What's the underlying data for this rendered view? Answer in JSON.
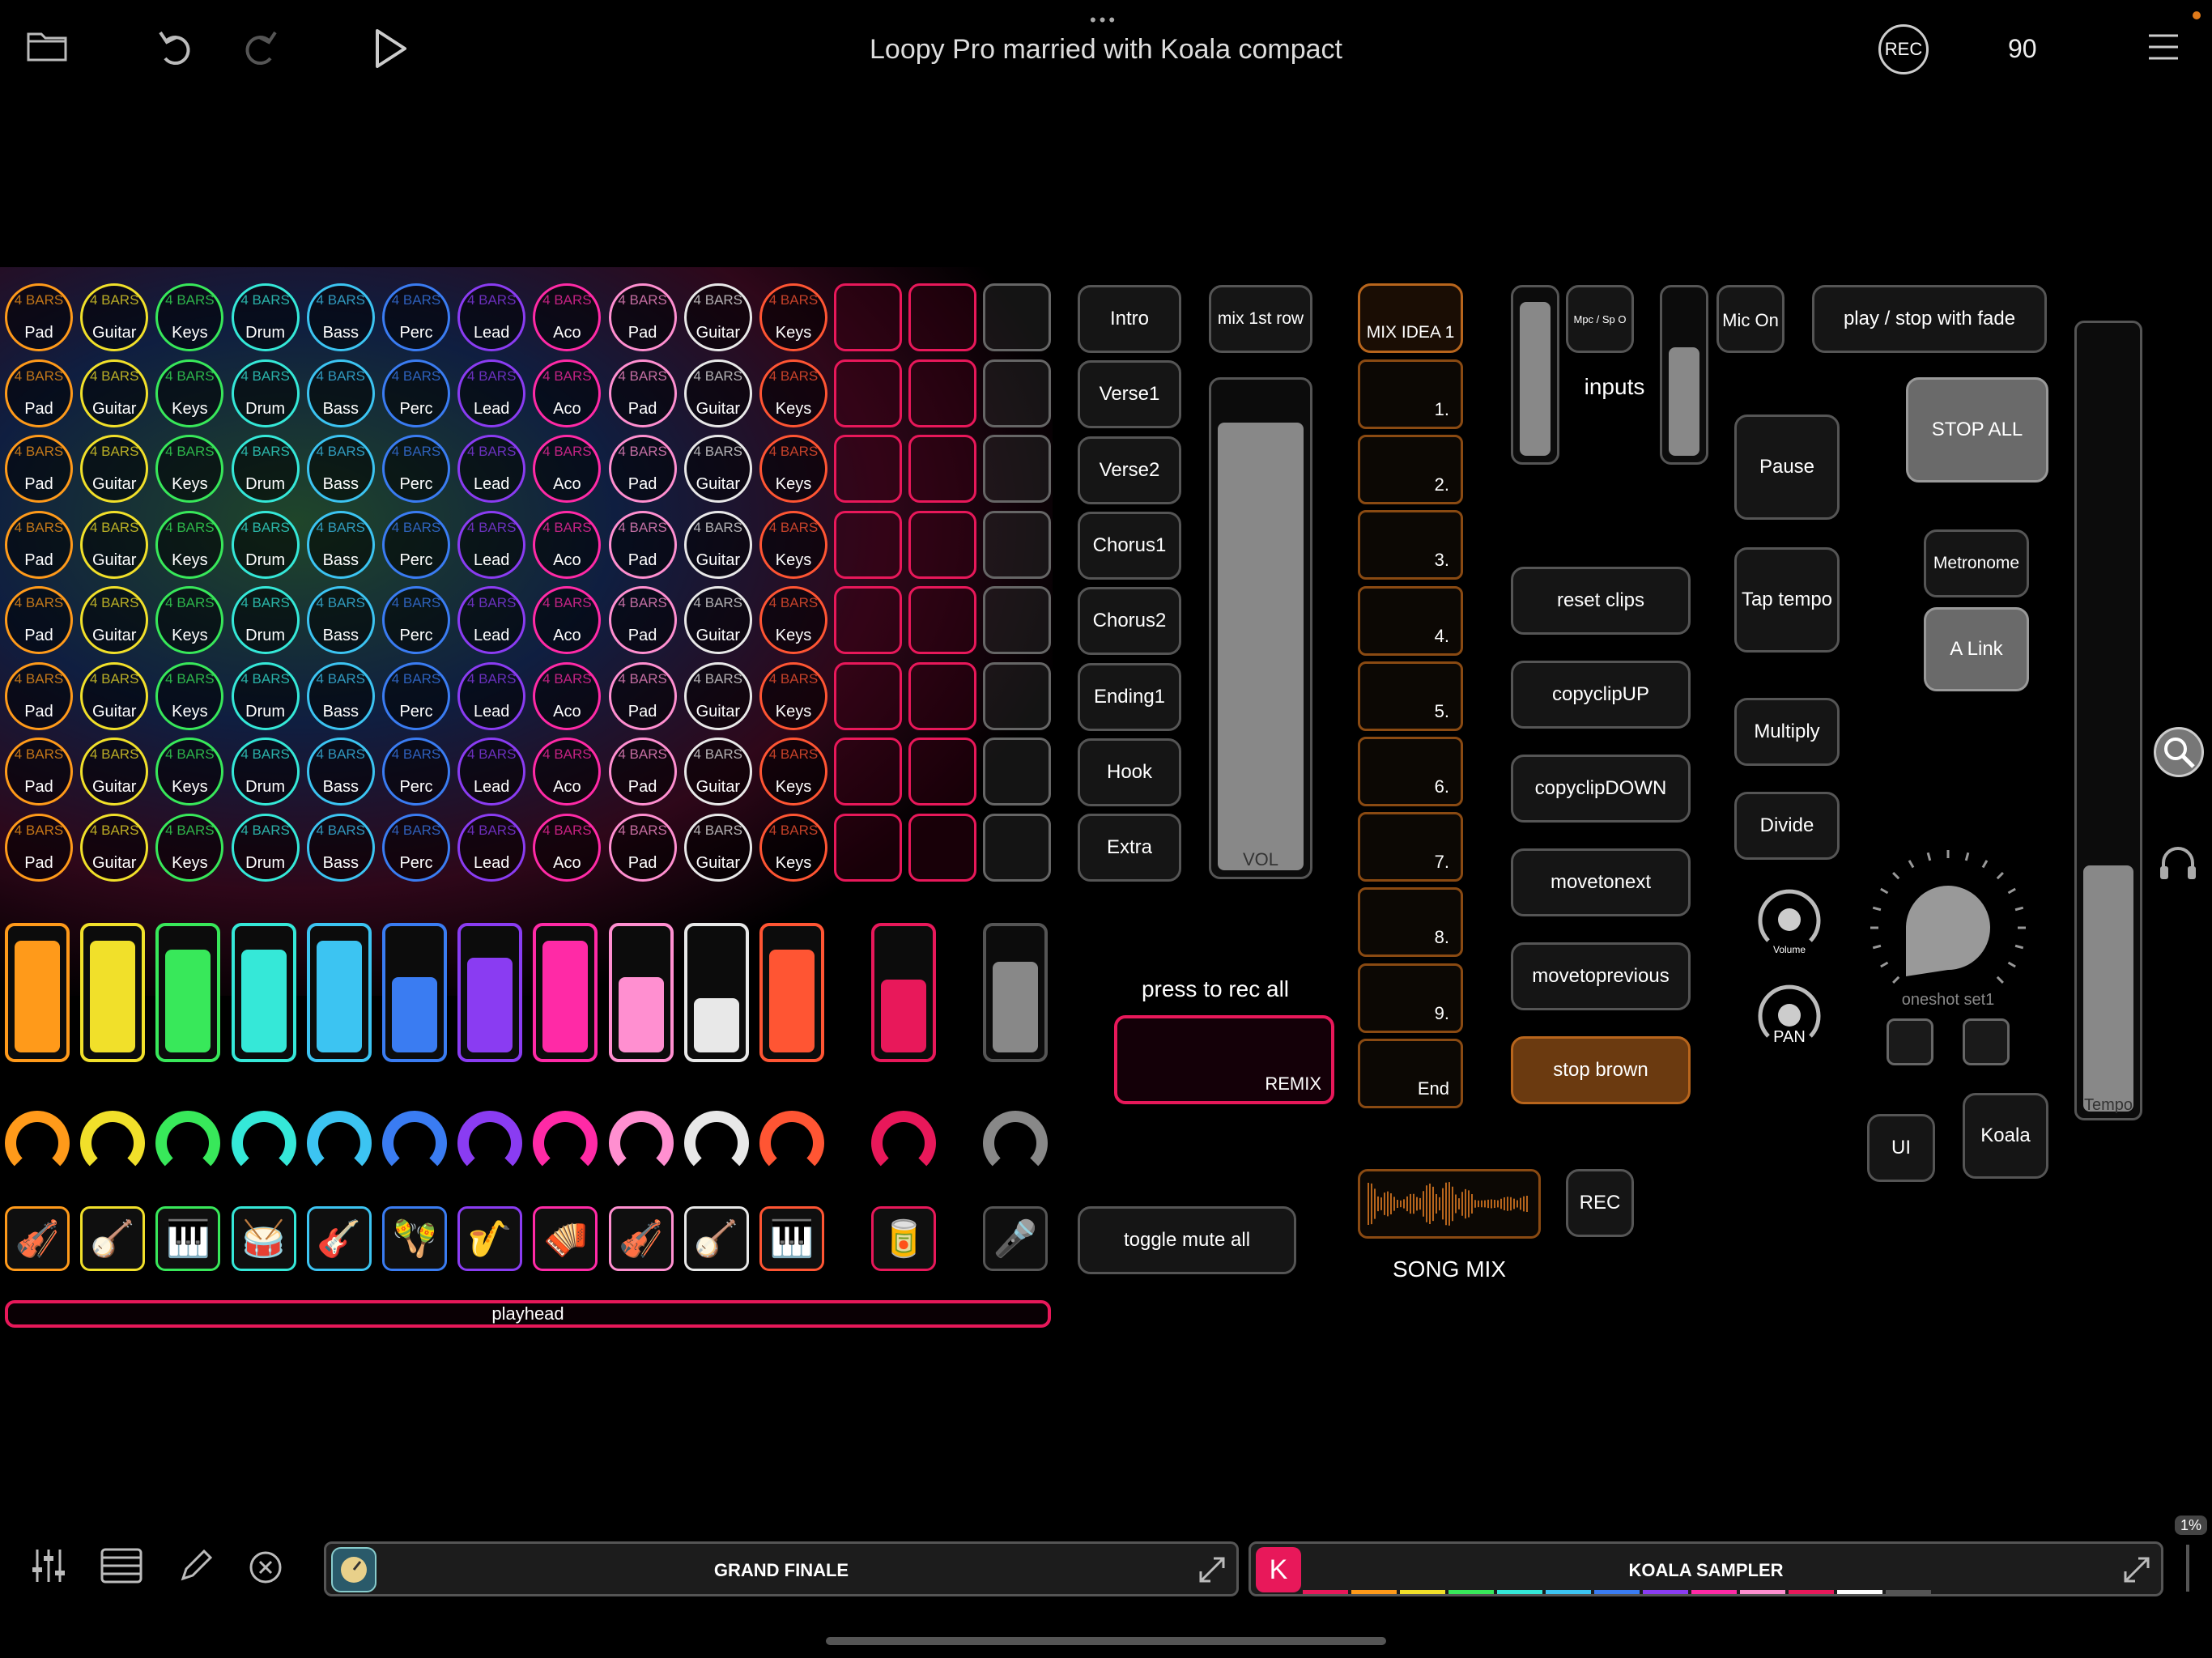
{
  "topbar": {
    "title": "Loopy Pro married with Koala compact",
    "rec_label": "REC",
    "tempo": "90",
    "icons": [
      "folder-icon",
      "undo-icon",
      "redo-icon",
      "play-icon",
      "menu-icon"
    ]
  },
  "grid": {
    "bars_text": "4 BARS",
    "columns": [
      {
        "label": "Pad",
        "color": "#ff9a1a",
        "fader": 0.92,
        "knob": 0.9
      },
      {
        "label": "Guitar",
        "color": "#f1e02a",
        "fader": 0.92,
        "knob": 0.35
      },
      {
        "label": "Keys",
        "color": "#38e85a",
        "fader": 0.85,
        "knob": 0.9
      },
      {
        "label": "Drum",
        "color": "#35e8d8",
        "fader": 0.85,
        "knob": 0.9
      },
      {
        "label": "Bass",
        "color": "#3cc4f2",
        "fader": 0.92,
        "knob": 0.6
      },
      {
        "label": "Perc",
        "color": "#3a7cf2",
        "fader": 0.62,
        "knob": 0.6
      },
      {
        "label": "Lead",
        "color": "#8a3cf2",
        "fader": 0.78,
        "knob": 0.55
      },
      {
        "label": "Aco",
        "color": "#ff2aa6",
        "fader": 0.92,
        "knob": 0.6
      },
      {
        "label": "Pad",
        "color": "#ff8fd0",
        "fader": 0.62,
        "knob": 0.6
      },
      {
        "label": "Guitar",
        "color": "#e8e8e8",
        "fader": 0.45,
        "knob": 0.85
      },
      {
        "label": "Keys",
        "color": "#ff5533",
        "fader": 0.85,
        "knob": 0.55
      }
    ],
    "extra_columns": [
      {
        "color": "#e8185a",
        "fader": 0.6,
        "knob": 0.55
      },
      {
        "color": "#555555",
        "fader": 0.75,
        "knob": 0.55
      }
    ],
    "instruments": [
      "🎻",
      "🪕",
      "🎹",
      "🥁",
      "🎸",
      "🪇",
      "🎷",
      "🪗",
      "🎻",
      "🪕",
      "🎹"
    ],
    "extra_instruments": [
      "🥫",
      "🎤"
    ],
    "playhead_label": "playhead"
  },
  "scenes": [
    "Intro",
    "Verse1",
    "Verse2",
    "Chorus1",
    "Chorus2",
    "Ending1",
    "Hook",
    "Extra"
  ],
  "mix": {
    "mix_first_row": "mix 1st row",
    "vol_label": "VOL",
    "vol_level": 0.9,
    "press_to_rec_all": "press to rec all",
    "remix_label": "REMIX",
    "toggle_mute_all": "toggle mute all"
  },
  "song": {
    "mix_idea": "MIX IDEA 1",
    "slots": [
      "1.",
      "2.",
      "3.",
      "4.",
      "5.",
      "6.",
      "7.",
      "8.",
      "9.",
      "End"
    ],
    "song_mix_label": "SONG MIX",
    "rec_label": "REC"
  },
  "controls": {
    "mpc_label": "Mpc / Sp O",
    "inputs_label": "inputs",
    "mic_on": "Mic On",
    "play_stop_fade": "play / stop with fade",
    "stop_all": "STOP ALL",
    "pause": "Pause",
    "tap_tempo": "Tap tempo",
    "multiply": "Multiply",
    "divide": "Divide",
    "reset_clips": "reset clips",
    "copyclip_up": "copyclipUP",
    "copyclip_down": "copyclipDOWN",
    "movetonext": "movetonext",
    "movetoprevious": "movetoprevious",
    "stop_brown": "stop brown",
    "metronome": "Metronome",
    "a_link": "A Link",
    "volume_label": "Volume",
    "pan_label": "PAN",
    "oneshot_label": "oneshot set1",
    "ui_label": "UI",
    "koala_label": "Koala",
    "tempo_label": "Tempo",
    "tempo_level": 0.31
  },
  "bottombar": {
    "left_plugin": "GRAND FINALE",
    "right_plugin": "KOALA SAMPLER",
    "koala_logo": "K",
    "cpu_badge": "1%",
    "icons": [
      "mixer-icon",
      "list-icon",
      "pencil-icon",
      "close-circle-icon"
    ]
  }
}
